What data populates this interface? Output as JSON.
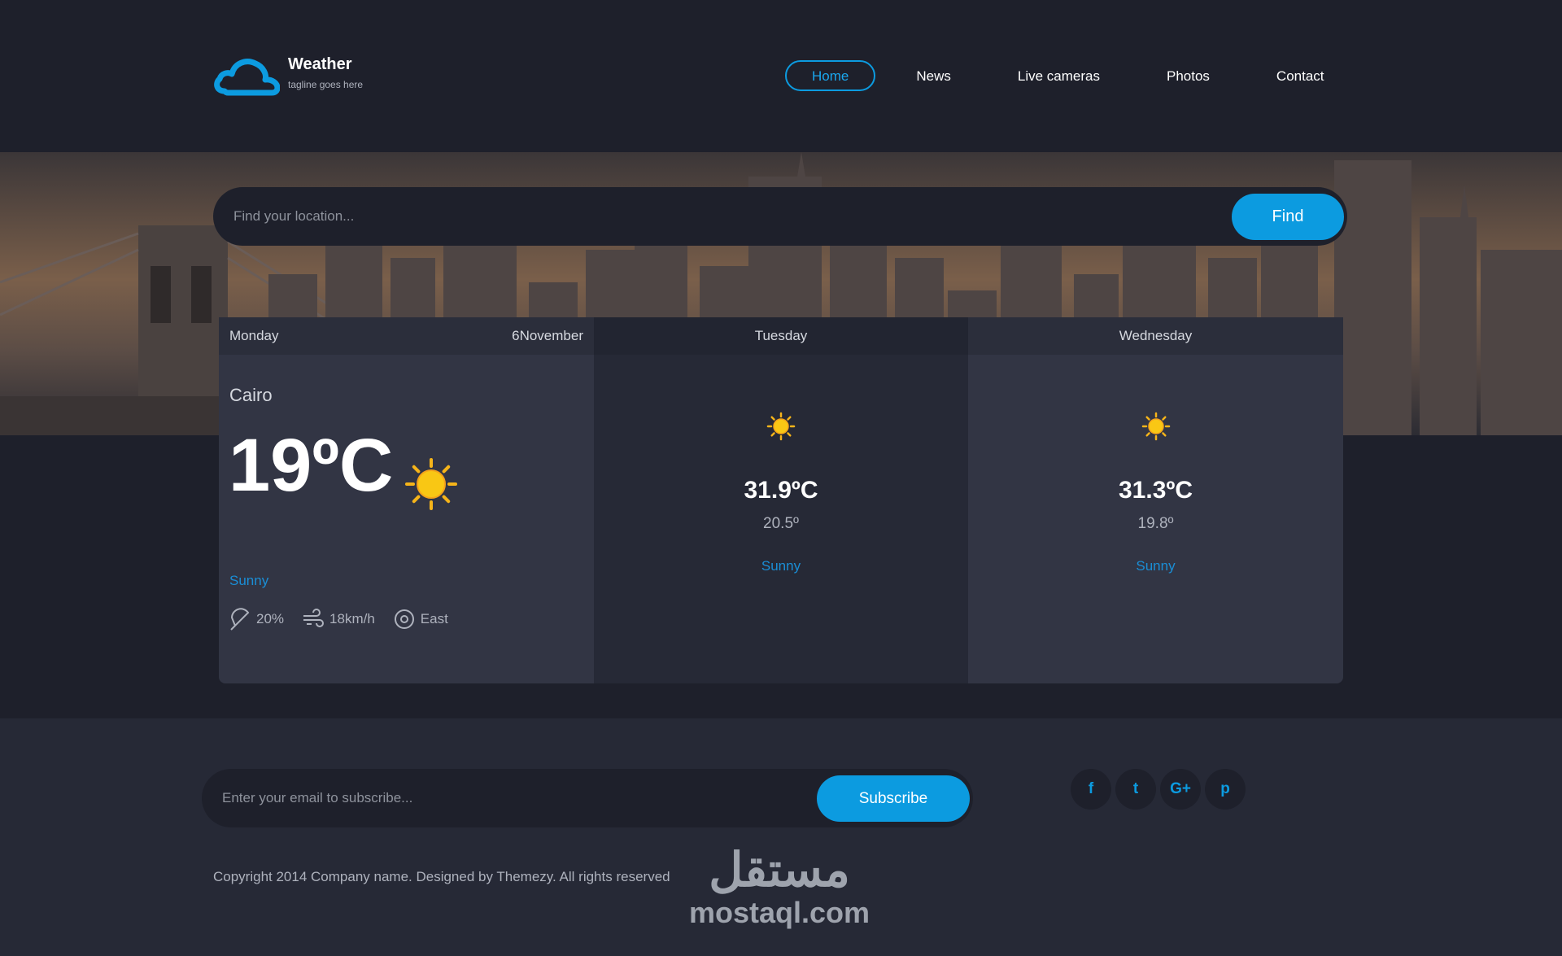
{
  "brand": {
    "title": "Weather",
    "tagline": "tagline goes here"
  },
  "nav": {
    "items": [
      {
        "label": "Home",
        "active": true
      },
      {
        "label": "News",
        "active": false
      },
      {
        "label": "Live cameras",
        "active": false
      },
      {
        "label": "Photos",
        "active": false
      },
      {
        "label": "Contact",
        "active": false
      }
    ]
  },
  "search": {
    "placeholder": "Find your location...",
    "button_label": "Find"
  },
  "forecast": {
    "today": {
      "day": "Monday",
      "date": "6November",
      "city": "Cairo",
      "temp": "19ºC",
      "condition": "Sunny",
      "stats": {
        "rain": "20%",
        "wind_speed": "18km/h",
        "wind_dir": "East"
      },
      "icon": "sun-icon"
    },
    "next": [
      {
        "day": "Tuesday",
        "max": "31.9ºC",
        "min": "20.5º",
        "condition": "Sunny",
        "icon": "sun-icon"
      },
      {
        "day": "Wednesday",
        "max": "31.3ºC",
        "min": "19.8º",
        "condition": "Sunny",
        "icon": "sun-icon"
      }
    ]
  },
  "subscribe": {
    "placeholder": "Enter your email to subscribe...",
    "button_label": "Subscribe"
  },
  "social": [
    {
      "name": "facebook-icon",
      "glyph": "f"
    },
    {
      "name": "twitter-icon",
      "glyph": "t"
    },
    {
      "name": "google-plus-icon",
      "glyph": "G+"
    },
    {
      "name": "pinterest-icon",
      "glyph": "p"
    }
  ],
  "footer": {
    "copyright": "Copyright 2014 Company name. Designed by Themezy. All rights reserved"
  },
  "watermark": {
    "arabic": "مستقل",
    "latin": "mostaql.com"
  },
  "colors": {
    "accent": "#0c9be0",
    "background": "#1e202b",
    "card": "#323544",
    "condition": "#1a8ed6"
  }
}
